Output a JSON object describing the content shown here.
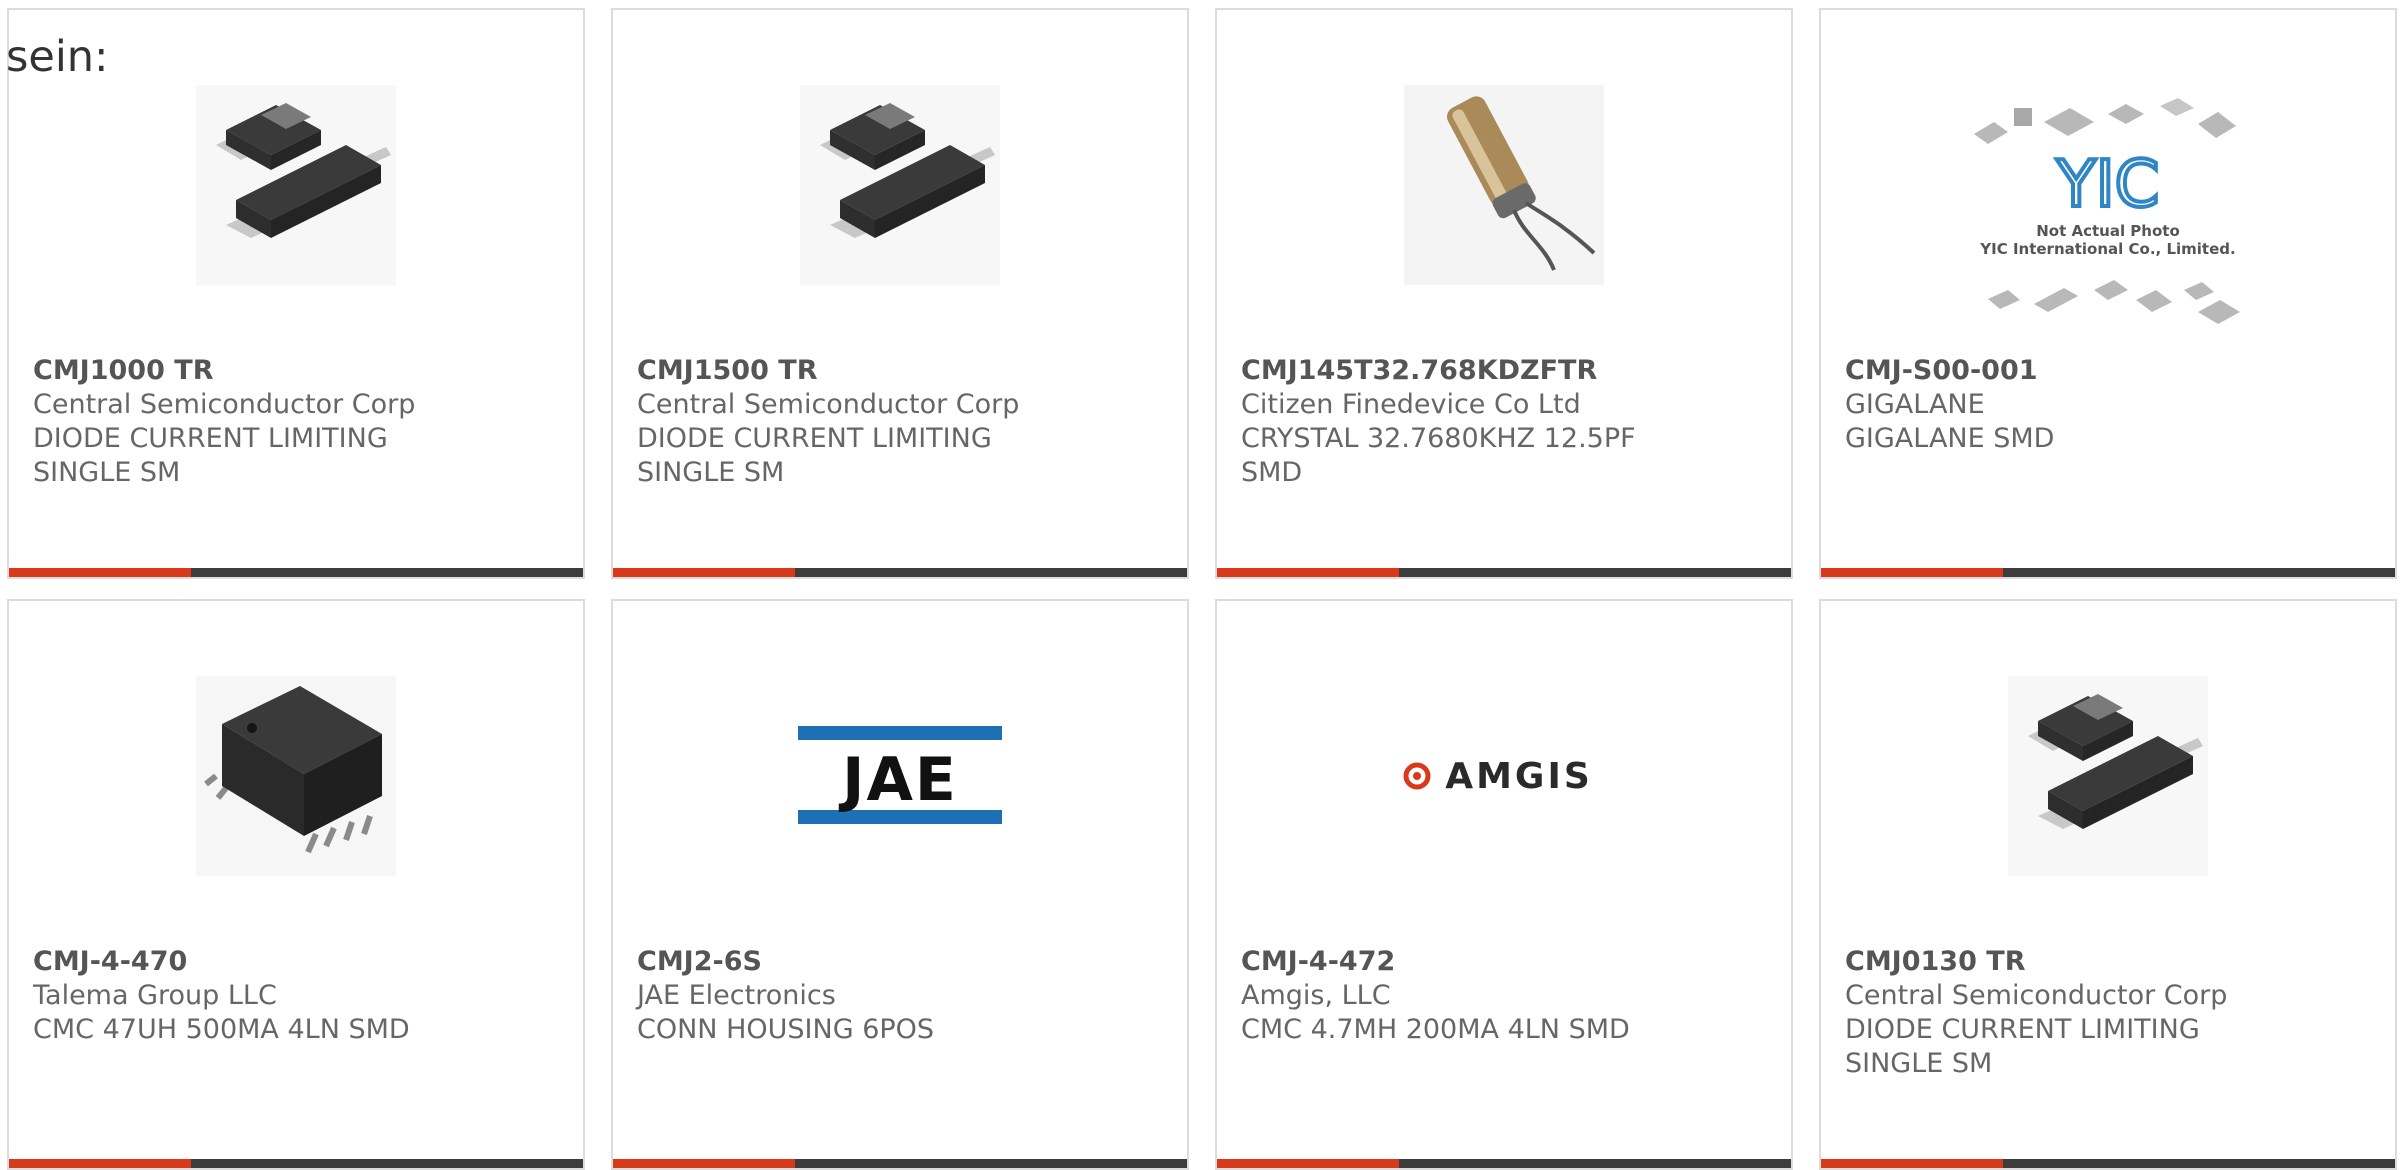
{
  "leading_text": "sein:",
  "colors": {
    "accent": "#d9391b",
    "bar": "#3c3c3c",
    "card_border": "#dcdcdc",
    "text": "#666666"
  },
  "products": [
    {
      "part_number": "CMJ1000 TR",
      "manufacturer": "Central Semiconductor Corp",
      "description": "DIODE CURRENT LIMITING SINGLE SM",
      "image": "smd-diode-package"
    },
    {
      "part_number": "CMJ1500 TR",
      "manufacturer": "Central Semiconductor Corp",
      "description": "DIODE CURRENT LIMITING SINGLE SM",
      "image": "smd-diode-package"
    },
    {
      "part_number": "CMJ145T32.768KDZFTR",
      "manufacturer": "Citizen Finedevice Co Ltd",
      "description": "CRYSTAL 32.7680KHZ 12.5PF SMD",
      "image": "crystal-cylinder"
    },
    {
      "part_number": "CMJ-S00-001",
      "manufacturer": "GIGALANE",
      "description": "GIGALANE SMD",
      "image": "yic-placeholder",
      "image_text": {
        "logo": "YIC",
        "line1": "Not Actual Photo",
        "line2": "YIC International Co., Limited."
      }
    },
    {
      "part_number": "CMJ-4-470",
      "manufacturer": "Talema Group LLC",
      "description": "CMC 47UH 500MA 4LN SMD",
      "image": "common-mode-choke"
    },
    {
      "part_number": "CMJ2-6S",
      "manufacturer": "JAE Electronics",
      "description": "CONN HOUSING 6POS",
      "image": "jae-logo",
      "image_text": {
        "logo": "JAE"
      }
    },
    {
      "part_number": "CMJ-4-472",
      "manufacturer": "Amgis, LLC",
      "description": "CMC 4.7MH 200MA 4LN SMD",
      "image": "amgis-logo",
      "image_text": {
        "logo": "AMGIS"
      }
    },
    {
      "part_number": "CMJ0130 TR",
      "manufacturer": "Central Semiconductor Corp",
      "description": "DIODE CURRENT LIMITING SINGLE SM",
      "image": "smd-diode-package"
    }
  ]
}
